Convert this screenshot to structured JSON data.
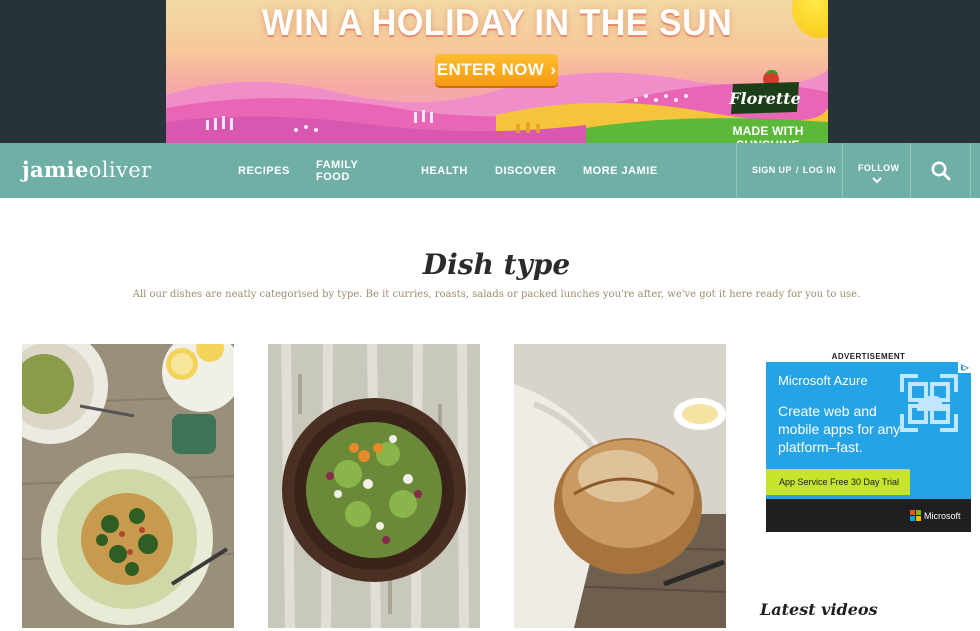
{
  "banner": {
    "title": "WIN A HOLIDAY IN THE SUN",
    "cta": "ENTER NOW",
    "cta_chevron": "›",
    "logo_text": "Florette",
    "tagline": "MADE WITH SUNSHINE"
  },
  "nav": {
    "brand_first": "jamie",
    "brand_second": "oliver",
    "links": [
      "RECIPES",
      "FAMILY FOOD",
      "HEALTH",
      "DISCOVER",
      "MORE JAMIE"
    ],
    "sign_up": "SIGN UP",
    "slash": "/",
    "log_in": "LOG IN",
    "follow": "FOLLOW",
    "icons": [
      "chevron-down-icon",
      "search-icon"
    ]
  },
  "page": {
    "title": "Dish type",
    "intro": "All our dishes are neatly categorised by type. Be it curries, roasts, salads or packed lunches you're after, we've got it here ready for you to use."
  },
  "cards": [
    {
      "image": "pasta-dish-photo"
    },
    {
      "image": "salad-bowl-photo"
    },
    {
      "image": "bread-loaf-photo"
    }
  ],
  "ad": {
    "label": "ADVERTISEMENT",
    "brand": "Microsoft Azure",
    "body": "Create web and mobile apps for any platform–fast.",
    "cta": "App Service Free 30 Day Trial",
    "footer_brand": "Microsoft",
    "choices": "i▷",
    "colors": {
      "background": "#24a3e6",
      "cta": "#c7e42a",
      "footer": "#1f1f1f"
    }
  },
  "sidebar": {
    "latest_videos": "Latest videos"
  },
  "colors": {
    "nav": "#6fafa5",
    "ad_band": "#273338",
    "intro_text": "#a28b6c"
  }
}
